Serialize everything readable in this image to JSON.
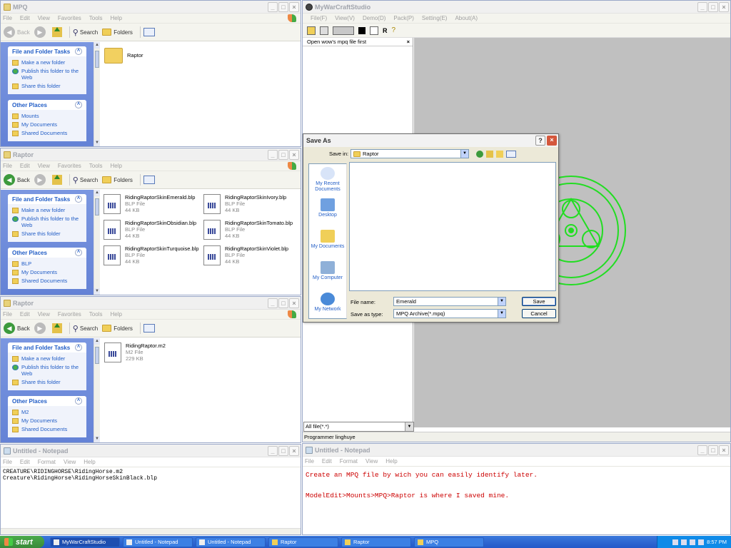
{
  "explorer_common": {
    "menu": [
      "File",
      "Edit",
      "View",
      "Favorites",
      "Tools",
      "Help"
    ],
    "back": "Back",
    "search": "Search",
    "folders": "Folders",
    "file_tasks_title": "File and Folder Tasks",
    "task_new_folder": "Make a new folder",
    "task_publish": "Publish this folder to the Web",
    "task_share": "Share this folder",
    "other_places_title": "Other Places",
    "my_documents": "My Documents",
    "shared_documents": "Shared Documents"
  },
  "win_mpq": {
    "title": "MPQ",
    "other_place_1": "Mounts",
    "folder_name": "Raptor"
  },
  "win_raptor_blp": {
    "title": "Raptor",
    "other_place_1": "BLP",
    "files": [
      {
        "name": "RidingRaptorSkinEmerald.blp",
        "type": "BLP File",
        "size": "44 KB"
      },
      {
        "name": "RidingRaptorSkinIvory.blp",
        "type": "BLP File",
        "size": "44 KB"
      },
      {
        "name": "RidingRaptorSkinObsidian.blp",
        "type": "BLP File",
        "size": "44 KB"
      },
      {
        "name": "RidingRaptorSkinTomato.blp",
        "type": "BLP File",
        "size": "44 KB"
      },
      {
        "name": "RidingRaptorSkinTurquoise.blp",
        "type": "BLP File",
        "size": "44 KB"
      },
      {
        "name": "RidingRaptorSkinViolet.blp",
        "type": "BLP File",
        "size": "44 KB"
      }
    ]
  },
  "win_raptor_m2": {
    "title": "Raptor",
    "other_place_1": "M2",
    "file": {
      "name": "RidingRaptor.m2",
      "type": "M2 File",
      "size": "229 KB"
    }
  },
  "notepad_left": {
    "title": "Untitled - Notepad",
    "menu": [
      "File",
      "Edit",
      "Format",
      "View",
      "Help"
    ],
    "text": "CREATURE\\RIDINGHORSE\\RidingHorse.m2\nCreature\\RidingHorse\\RidingHorseSkinBlack.blp"
  },
  "mws": {
    "title": "MyWarCraftStudio",
    "menu": [
      "File(F)",
      "View(V)",
      "Demo(D)",
      "Pack(P)",
      "Setting(E)",
      "About(A)"
    ],
    "tree_header": "Open wow's mpq file first",
    "tree_close": "×",
    "toolbar_r": "R",
    "filter": "All file(*.*)",
    "status": "Programmer linghuye",
    "accent": "#22dd22"
  },
  "dialog": {
    "title": "Save As",
    "help": "?",
    "close": "×",
    "save_in_label": "Save in:",
    "save_in_value": "Raptor",
    "places": [
      "My Recent Documents",
      "Desktop",
      "My Documents",
      "My Computer",
      "My Network"
    ],
    "filename_label": "File name:",
    "filename_value": "Emerald",
    "type_label": "Save as type:",
    "type_value": "MPQ Archive(*.mpq)",
    "save_button": "Save",
    "cancel_button": "Cancel"
  },
  "notepad_right": {
    "title": "Untitled - Notepad",
    "menu": [
      "File",
      "Edit",
      "Format",
      "View",
      "Help"
    ],
    "line1": "Create an MPQ file by wich you can easily identify later.",
    "line2": "ModelEdit>Mounts>MPQ>Raptor is where I saved mine.",
    "text_color": "#cc0000"
  },
  "taskbar": {
    "start": "start",
    "tasks": [
      "MyWarCraftStudio",
      "Untitled - Notepad",
      "Untitled - Notepad",
      "Raptor",
      "Raptor",
      "MPQ"
    ],
    "clock": "8:57 PM"
  }
}
